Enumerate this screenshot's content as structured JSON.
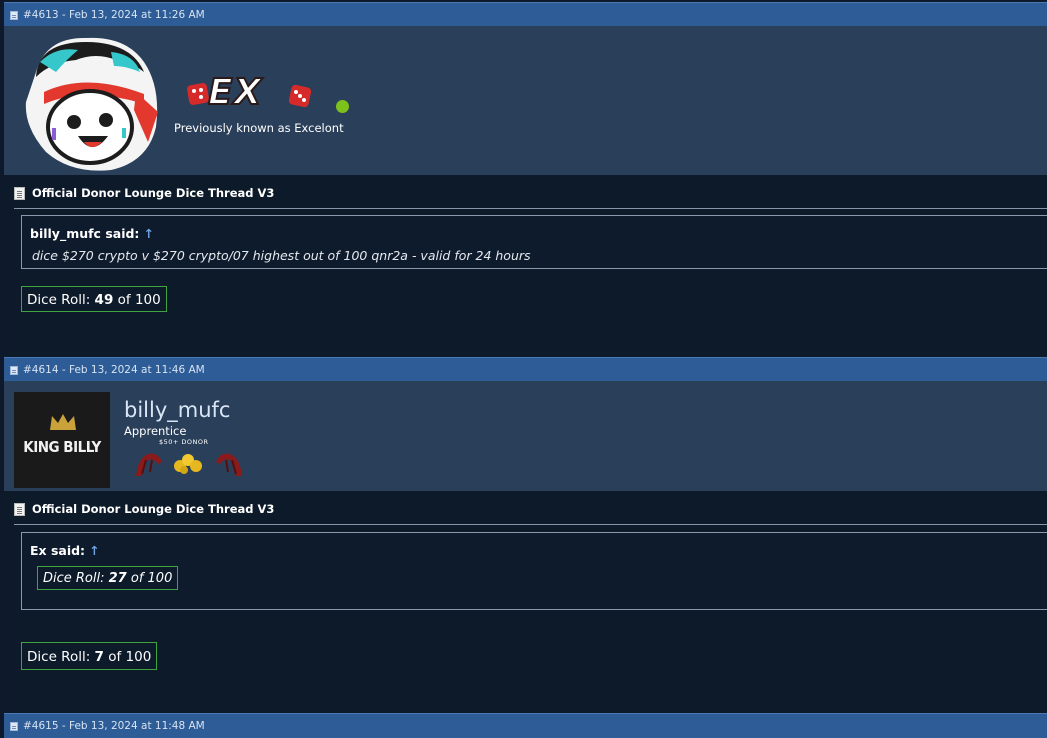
{
  "posts": [
    {
      "header": "#4613 - Feb 13, 2024 at 11:26 AM",
      "username_logo": "EX",
      "user_tagline": "Previously known as Excelont",
      "thread_title": "Official Donor Lounge Dice Thread V3",
      "quote": {
        "author": "billy_mufc said:",
        "arrow": "↑",
        "text": "dice $270 crypto v $270 crypto/07 highest out of 100 qnr2a - valid for 24 hours"
      },
      "dice": {
        "label": "Dice Roll:",
        "value": "49",
        "suffix": "of 100"
      }
    },
    {
      "header": "#4614 - Feb 13, 2024 at 11:46 AM",
      "avatar_text": "KING BILLY",
      "username": "billy_mufc",
      "user_title": "Apprentice",
      "badge_text": "$50+ DONOR",
      "thread_title": "Official Donor Lounge Dice Thread V3",
      "quote": {
        "author": "Ex said:",
        "arrow": "↑",
        "dice": {
          "label": "Dice Roll:",
          "value": "27",
          "suffix": "of 100"
        }
      },
      "dice": {
        "label": "Dice Roll:",
        "value": "7",
        "suffix": "of 100"
      }
    },
    {
      "header": "#4615 - Feb 13, 2024 at 11:48 AM"
    }
  ],
  "colors": {
    "header_bar": "#2d5c97",
    "profile_bg": "#2a3f5a",
    "body_bg": "#0d1a2a",
    "dice_border": "#3fa33f",
    "online_dot": "#7cc21b"
  }
}
